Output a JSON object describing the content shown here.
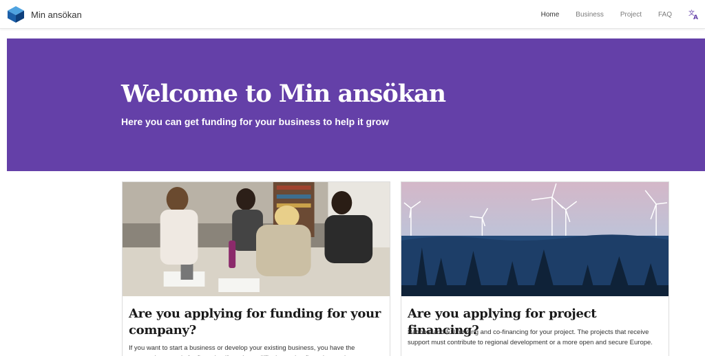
{
  "header": {
    "brand_name": "Min ansökan",
    "brand_icon": "cube-logo-icon",
    "nav": [
      {
        "label": "Home",
        "active": true
      },
      {
        "label": "Business",
        "active": false
      },
      {
        "label": "Project",
        "active": false
      },
      {
        "label": "FAQ",
        "active": false
      }
    ],
    "language_icon": "translate-icon"
  },
  "hero": {
    "title": "Welcome to Min ansökan",
    "subtitle": "Here you can get funding for your business to help it grow",
    "background_color": "#6440a8"
  },
  "cards": [
    {
      "image": "office-team-photo",
      "title": "Are you applying for funding for your company?",
      "text": "If you want to start a business or develop your existing business, you have the opportunity to apply for financing if you have difficulty getting financing on the"
    },
    {
      "image": "wind-turbines-forest-photo",
      "title": "Are you applying for project financing?",
      "text": "National and EU funding and co-financing for your project. The projects that receive support must contribute to regional development or a more open and secure Europe."
    }
  ]
}
